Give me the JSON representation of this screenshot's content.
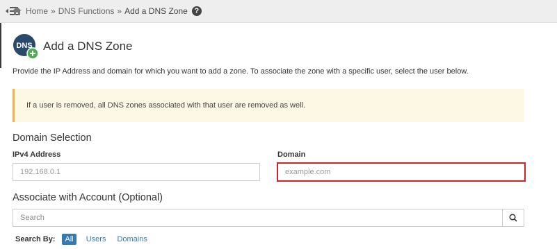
{
  "breadcrumb": {
    "home": "Home",
    "separator": "»",
    "dns_functions": "DNS Functions",
    "current": "Add a DNS Zone",
    "help": "?"
  },
  "header": {
    "logo_text": "DNS",
    "title": "Add a DNS Zone"
  },
  "description": "Provide the IP Address and domain for which you want to add a zone. To associate the zone with a specific user, select the user below.",
  "alert": "If a user is removed, all DNS zones associated with that user are removed as well.",
  "domain_selection": {
    "heading": "Domain Selection",
    "ipv4_label": "IPv4 Address",
    "ipv4_placeholder": "192.168.0.1",
    "domain_label": "Domain",
    "domain_placeholder": "example.com"
  },
  "account": {
    "heading": "Associate with Account (Optional)",
    "search_placeholder": "Search",
    "search_by_label": "Search By:",
    "filters": [
      "All",
      "Users",
      "Domains"
    ]
  },
  "colors": {
    "accent": "#337ab7",
    "alert_bg": "#fcf8e3",
    "alert_border": "#f0ad4e",
    "highlight": "#d0202a",
    "logo": "#2b4a6b",
    "logo_plus": "#4caf50"
  }
}
